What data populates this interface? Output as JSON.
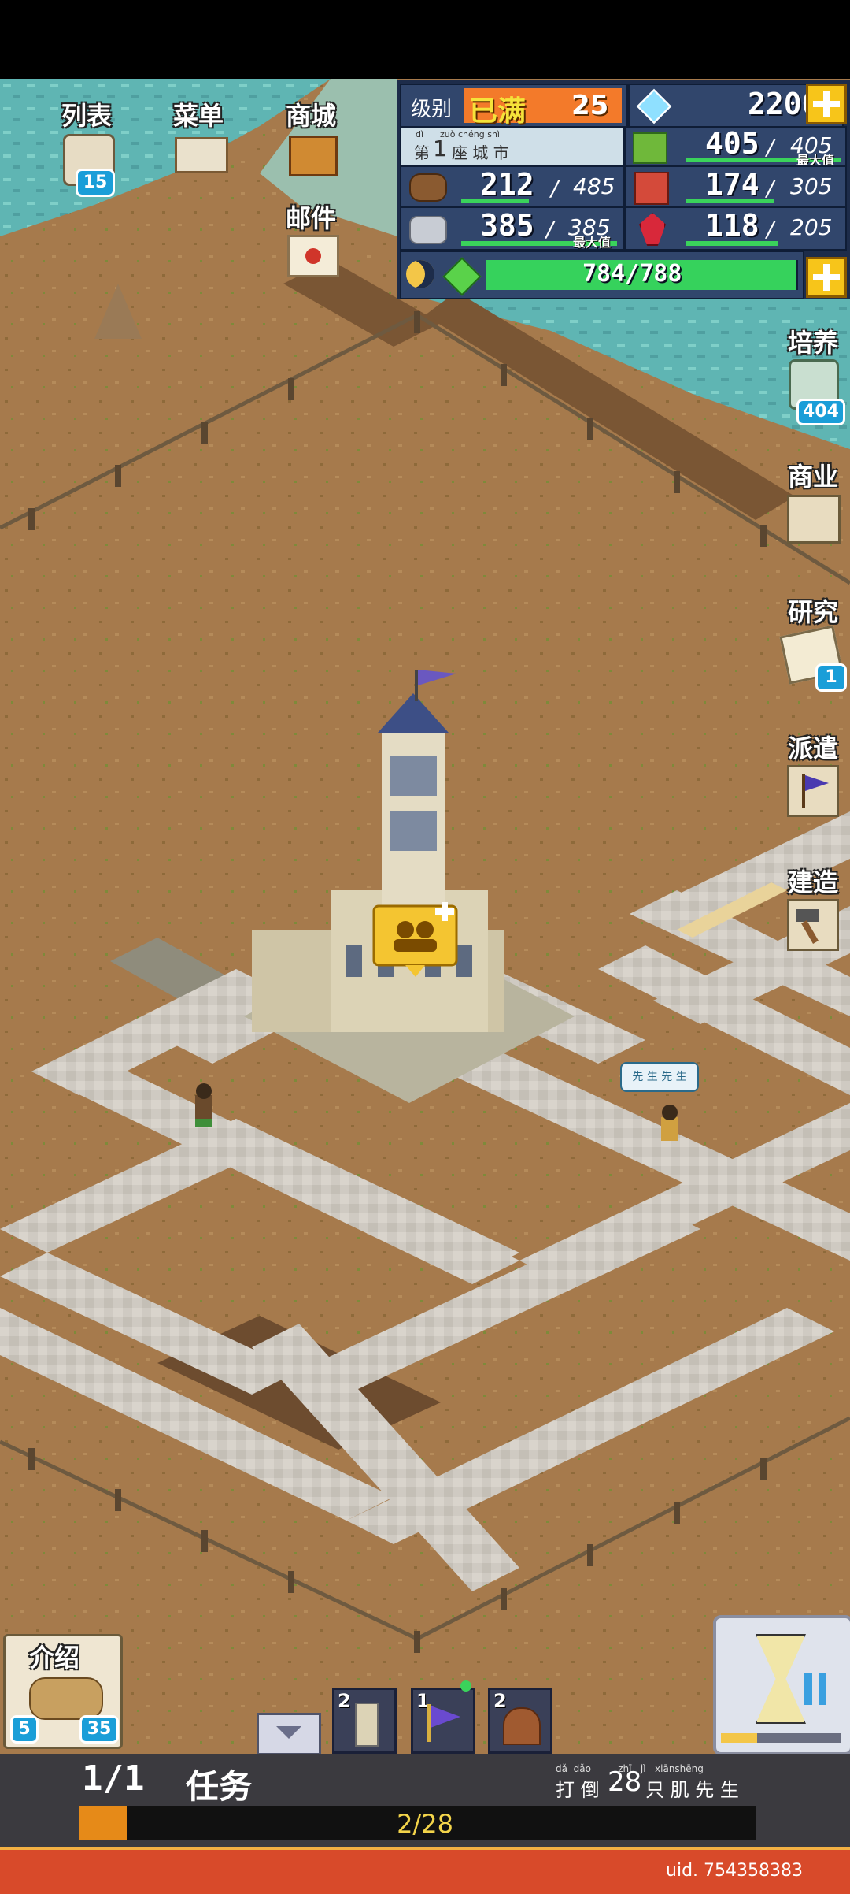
{
  "left_menu": {
    "list": {
      "label": "列表",
      "badge": "15"
    },
    "menu": {
      "label": "菜单"
    },
    "shop": {
      "label": "商城"
    },
    "mail": {
      "label": "邮件"
    }
  },
  "hud": {
    "level_label": "级别",
    "level_rank": "已满",
    "level_value": "25",
    "gems": "2200",
    "city_ordinal_prefix": "第",
    "city_ordinal": "1",
    "city_name": "座 城 市",
    "city_pinyin": "dì      zuò chéng shì",
    "food_current": "405",
    "food_max": "405",
    "max_tag": "最大值",
    "wood_current": "212",
    "wood_max": "485",
    "goods_current": "174",
    "goods_max": "305",
    "stone_current": "385",
    "stone_max": "385",
    "ruby_current": "118",
    "ruby_max": "205",
    "energy_text": "784/788",
    "energy_fraction": 0.995,
    "separator": "/"
  },
  "right_menu": {
    "train": {
      "label": "培养",
      "badge": "404"
    },
    "business": {
      "label": "商业"
    },
    "research": {
      "label": "研究",
      "badge": "1"
    },
    "dispatch": {
      "label": "派遣"
    },
    "build": {
      "label": "建造"
    }
  },
  "map": {
    "npc_bubble": "先 生 先 生",
    "townhall_icon": "people-plus-icon"
  },
  "bottom": {
    "intro": {
      "label": "介绍",
      "badge_left": "5",
      "badge_right": "35"
    },
    "slot1_count": "2",
    "slot2_count": "1",
    "slot3_count": "2",
    "quest_count": "1/1",
    "quest_label": "任务",
    "quest_title_pinyin": "dǎ  dǎo         zhī   jì   xiānshēng",
    "quest_title_prefix": "打 倒",
    "quest_title_number": "28",
    "quest_title_suffix": "只 肌 先 生",
    "quest_progress_text": "2/28",
    "quest_progress_fraction": 0.0714,
    "uid": "uid. 754358383"
  }
}
